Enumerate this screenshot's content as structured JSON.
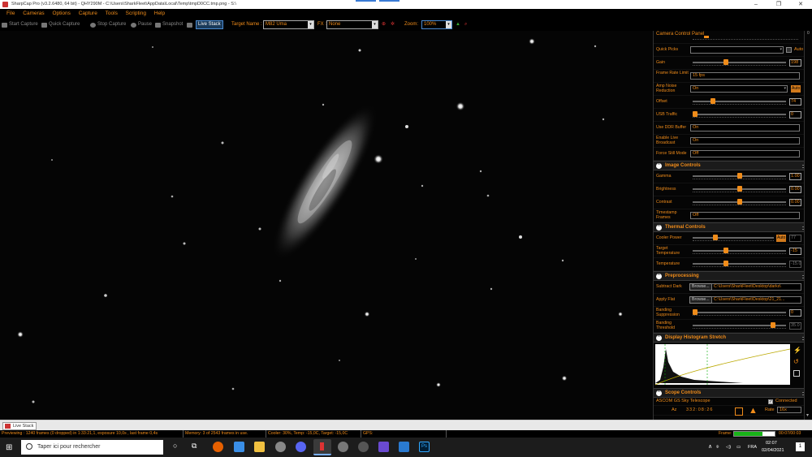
{
  "window": {
    "title": "SharpCap Pro (v3.2.6480, 64 bit) - QHY290M - C:\\Users\\SharkFleet\\AppData\\Local\\Temp\\tmpD0CC.tmp.png - S:\\"
  },
  "menu": [
    "File",
    "Cameras",
    "Options",
    "Capture",
    "Tools",
    "Scripting",
    "Help"
  ],
  "toolbar": {
    "start_capture": "Start Capture",
    "quick_capture": "Quick Capture",
    "stop_capture": "Stop Capture",
    "pause": "Pause",
    "snapshot": "Snapshot",
    "live_stack": "Live Stack",
    "target_label": "Target Name :",
    "target_value": "M82 Uma",
    "fx_label": "FX :",
    "fx_value": "None",
    "zoom_label": "Zoom:",
    "zoom_value": "100%"
  },
  "panel": {
    "title": "Camera Control Panel",
    "quick_picks": "Quick Picks",
    "auto": "Auto",
    "gain": {
      "label": "Gain",
      "value": "198",
      "level": 0.35
    },
    "frame_rate": {
      "label": "Frame Rate Limit",
      "value": "15 fps"
    },
    "amp_noise": {
      "label": "Amp Noise Reduction",
      "value": "On",
      "auto": "Auto"
    },
    "offset": {
      "label": "Offset",
      "value": "74",
      "level": 0.2
    },
    "usb": {
      "label": "USB Traffic",
      "value": "0",
      "level": 0.0
    },
    "ddr": {
      "label": "Use DDR Buffer",
      "value": "On"
    },
    "live_broadcast": {
      "label": "Enable Live Broadcast",
      "value": "On"
    },
    "force_still": {
      "label": "Force Still Mode",
      "value": "Off"
    },
    "image_controls": {
      "title": "Image Controls",
      "gamma": {
        "label": "Gamma",
        "value": "1.00",
        "level": 0.5
      },
      "brightness": {
        "label": "Brightness",
        "value": "0.00",
        "level": 0.5
      },
      "contrast": {
        "label": "Contrast",
        "value": "0.00",
        "level": 0.5
      },
      "timestamp": {
        "label": "Timestamp Frames",
        "value": "Off"
      }
    },
    "thermal": {
      "title": "Thermal Controls",
      "cooler": {
        "label": "Cooler Power",
        "value": "77",
        "auto": "Auto",
        "level": 0.27
      },
      "target_temp": {
        "label": "Target Temperature",
        "value": "-15",
        "level": 0.35
      },
      "temperature": {
        "label": "Temperature",
        "value": "-15.0",
        "level": 0.35
      }
    },
    "preprocessing": {
      "title": "Preprocessing",
      "dark": {
        "label": "Subtract Dark",
        "browse": "Browse...",
        "path": "C:\\Users\\SharkFleet\\Desktop\\darks\\"
      },
      "flat": {
        "label": "Apply Flat",
        "browse": "Browse...",
        "path": "C:\\Users\\SharkFleet\\Desktop\\21_21..."
      },
      "banding_sup": {
        "label": "Banding Suppression",
        "value": "0",
        "level": 0.0
      },
      "banding_thr": {
        "label": "Banding Threshold",
        "value": "35.0",
        "level": 0.88
      }
    },
    "histogram": {
      "title": "Display Histogram Stretch"
    },
    "scope": {
      "title": "Scope Controls",
      "name": "ASCOM GS Sky Telescope",
      "connected": "Connected",
      "az_label": "Az",
      "az_value": "332:08:26",
      "rate_label": "Rate",
      "rate_value": "16x"
    }
  },
  "tab": {
    "live_stack": "Live Stack"
  },
  "status": {
    "preview": "Previewing : 1240 frames (0 dropped) in 1:33:21,1, exposure 10,0s , last frame 0,4s",
    "memory": "Memory: 3 of 2543 frames in use.",
    "cooler": "Cooler: 30%, Temp: -15,0C, Target: -15,0C",
    "gps": "GPS:",
    "frame_label": "Frame:",
    "frame_time": "00:07/00:03",
    "frame_progress": 0.7
  },
  "taskbar": {
    "search": "Taper ici pour rechercher",
    "lang": "FRA",
    "time": "02:07",
    "date": "02/04/2021",
    "notif": "1"
  },
  "colors": {
    "accent": "#f08c1a",
    "progress": "#19b319"
  }
}
